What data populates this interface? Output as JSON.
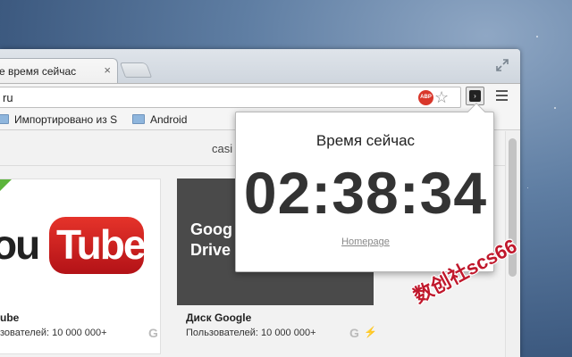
{
  "tab": {
    "title": "е время сейчас",
    "close": "×"
  },
  "omnibox": {
    "url": "ru"
  },
  "toolbar": {
    "abp_label": "ABP",
    "star": "☆",
    "ext_glyph": "›"
  },
  "bookmarks": {
    "items": [
      {
        "label": "Импортировано из S"
      },
      {
        "label": "Android"
      }
    ]
  },
  "page": {
    "header_text": "casi"
  },
  "apps": [
    {
      "name": "ube",
      "users": "зователей: 10 000 000+",
      "logo_you": "ou",
      "logo_tube": "Tube"
    },
    {
      "name": "Диск Google",
      "users": "Пользователей: 10 000 000+",
      "logo_line1": "Goog",
      "logo_line2": "Drive"
    }
  ],
  "popup": {
    "title": "Время сейчас",
    "time": "02:38:34",
    "link": "Homepage"
  },
  "watermark": "数创社scs66",
  "colors": {
    "accent_red": "#c0182c",
    "youtube_red": "#e5332a",
    "abp_red": "#d9372b"
  }
}
